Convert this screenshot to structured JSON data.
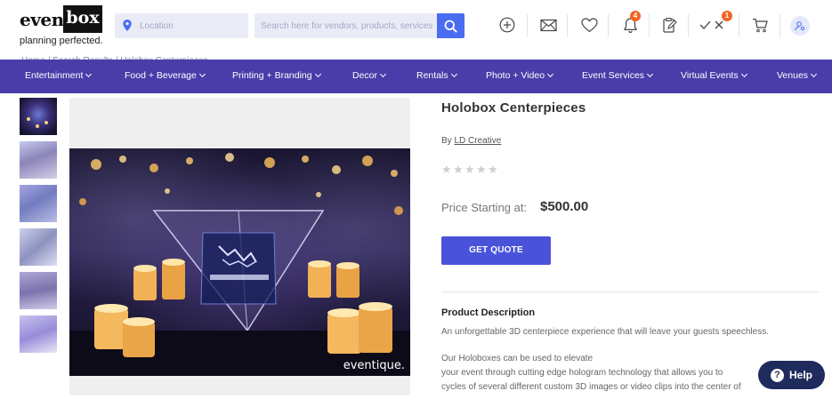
{
  "logo": {
    "word1": "event",
    "word2": "box",
    "tagline": "planning perfected."
  },
  "search": {
    "location_placeholder": "Location",
    "query_placeholder": "Search here for vendors, products, services"
  },
  "header_icons": [
    {
      "name": "add-circle-icon"
    },
    {
      "name": "mail-icon"
    },
    {
      "name": "heart-icon"
    },
    {
      "name": "bell-icon",
      "badge": "4"
    },
    {
      "name": "clipboard-edit-icon"
    },
    {
      "name": "check-x-icon",
      "badge": "1"
    },
    {
      "name": "cart-icon"
    },
    {
      "name": "user-avatar-icon"
    }
  ],
  "breadcrumb": {
    "home": "Home",
    "search": "Search Results",
    "current": "Holobox Centerpieces",
    "sep": "/"
  },
  "nav": {
    "items": [
      {
        "label": "Entertainment"
      },
      {
        "label": "Food + Beverage"
      },
      {
        "label": "Printing + Branding"
      },
      {
        "label": "Decor"
      },
      {
        "label": "Rentals"
      },
      {
        "label": "Photo + Video"
      },
      {
        "label": "Event Services"
      },
      {
        "label": "Virtual Events"
      },
      {
        "label": "Venues"
      }
    ]
  },
  "gallery": {
    "thumbnail_count": 6,
    "watermark": "eventique."
  },
  "product": {
    "title": "Holobox Centerpieces",
    "by_prefix": "By",
    "vendor": "LD Creative",
    "rating": 0,
    "rating_max": 5,
    "price_label": "Price Starting at:",
    "price_value": "$500.00",
    "quote_button": "GET QUOTE",
    "description_heading": "Product Description",
    "description_lines": [
      "An unforgettable 3D centerpiece experience that will leave your guests speechless.",
      "",
      "Our Holoboxes can be used to elevate",
      "your event through cutting edge hologram technology that allows you to",
      "cycles of several different custom 3D images or video clips into the center of"
    ]
  },
  "help": {
    "label": "Help",
    "icon": "question-icon"
  },
  "colors": {
    "nav_bg": "#4a3da9",
    "accent_blue": "#4a6cf0",
    "quote_btn": "#4953d9",
    "badge": "#f26522",
    "help_bg": "#1f2b5c"
  }
}
